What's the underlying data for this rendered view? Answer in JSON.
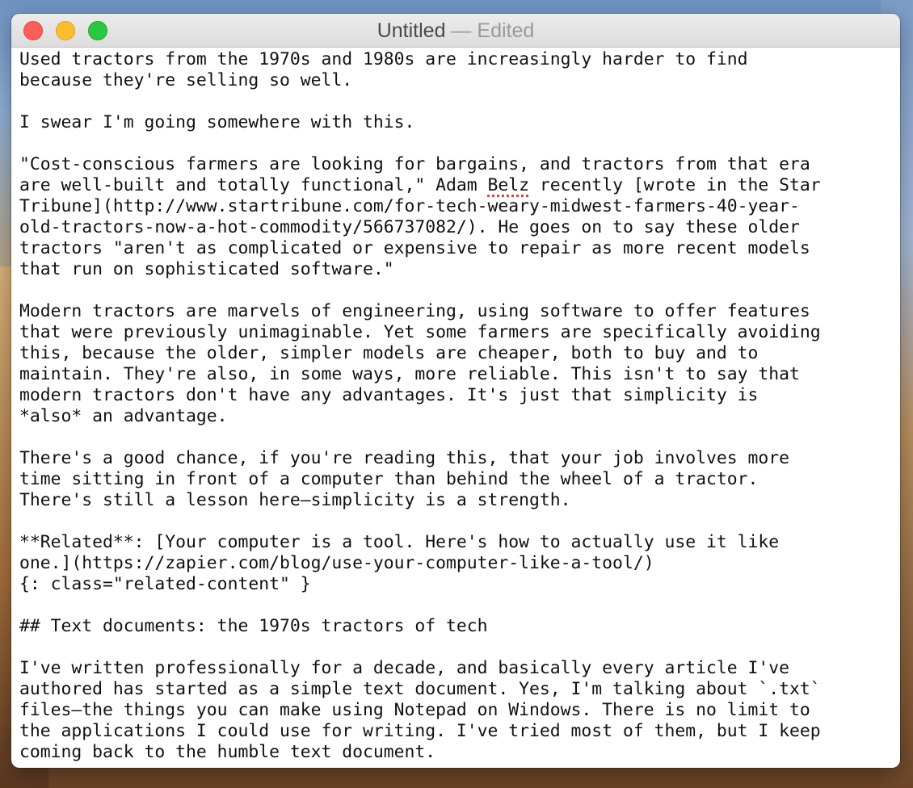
{
  "window": {
    "title": "Untitled",
    "title_separator": " — ",
    "title_status": "Edited"
  },
  "document": {
    "lines": [
      "Used tractors from the 1970s and 1980s are increasingly harder to find",
      "because they're selling so well.",
      "",
      "I swear I'm going somewhere with this.",
      "",
      "\"Cost-conscious farmers are looking for bargains, and tractors from that era",
      "are well-built and totally functional,\" Adam Belz recently [wrote in the Star",
      "Tribune](http://www.startribune.com/for-tech-weary-midwest-farmers-40-year-",
      "old-tractors-now-a-hot-commodity/566737082/). He goes on to say these older",
      "tractors \"aren't as complicated or expensive to repair as more recent models",
      "that run on sophisticated software.\"",
      "",
      "Modern tractors are marvels of engineering, using software to offer features",
      "that were previously unimaginable. Yet some farmers are specifically avoiding",
      "this, because the older, simpler models are cheaper, both to buy and to",
      "maintain. They're also, in some ways, more reliable. This isn't to say that",
      "modern tractors don't have any advantages. It's just that simplicity is",
      "*also* an advantage.",
      "",
      "There's a good chance, if you're reading this, that your job involves more",
      "time sitting in front of a computer than behind the wheel of a tractor.",
      "There's still a lesson here—simplicity is a strength.",
      "",
      "**Related**: [Your computer is a tool. Here's how to actually use it like",
      "one.](https://zapier.com/blog/use-your-computer-like-a-tool/)",
      "{: class=\"related-content\" }",
      "",
      "## Text documents: the 1970s tractors of tech",
      "",
      "I've written professionally for a decade, and basically every article I've",
      "authored has started as a simple text document. Yes, I'm talking about `.txt`",
      "files—the things you can make using Notepad on Windows. There is no limit to",
      "the applications I could use for writing. I've tried most of them, but I keep",
      "coming back to the humble text document."
    ],
    "line6_parts": {
      "before": "are well-built and totally functional,\" Adam ",
      "misspelled": "Belz",
      "after": " recently [wrote in the Star"
    }
  }
}
